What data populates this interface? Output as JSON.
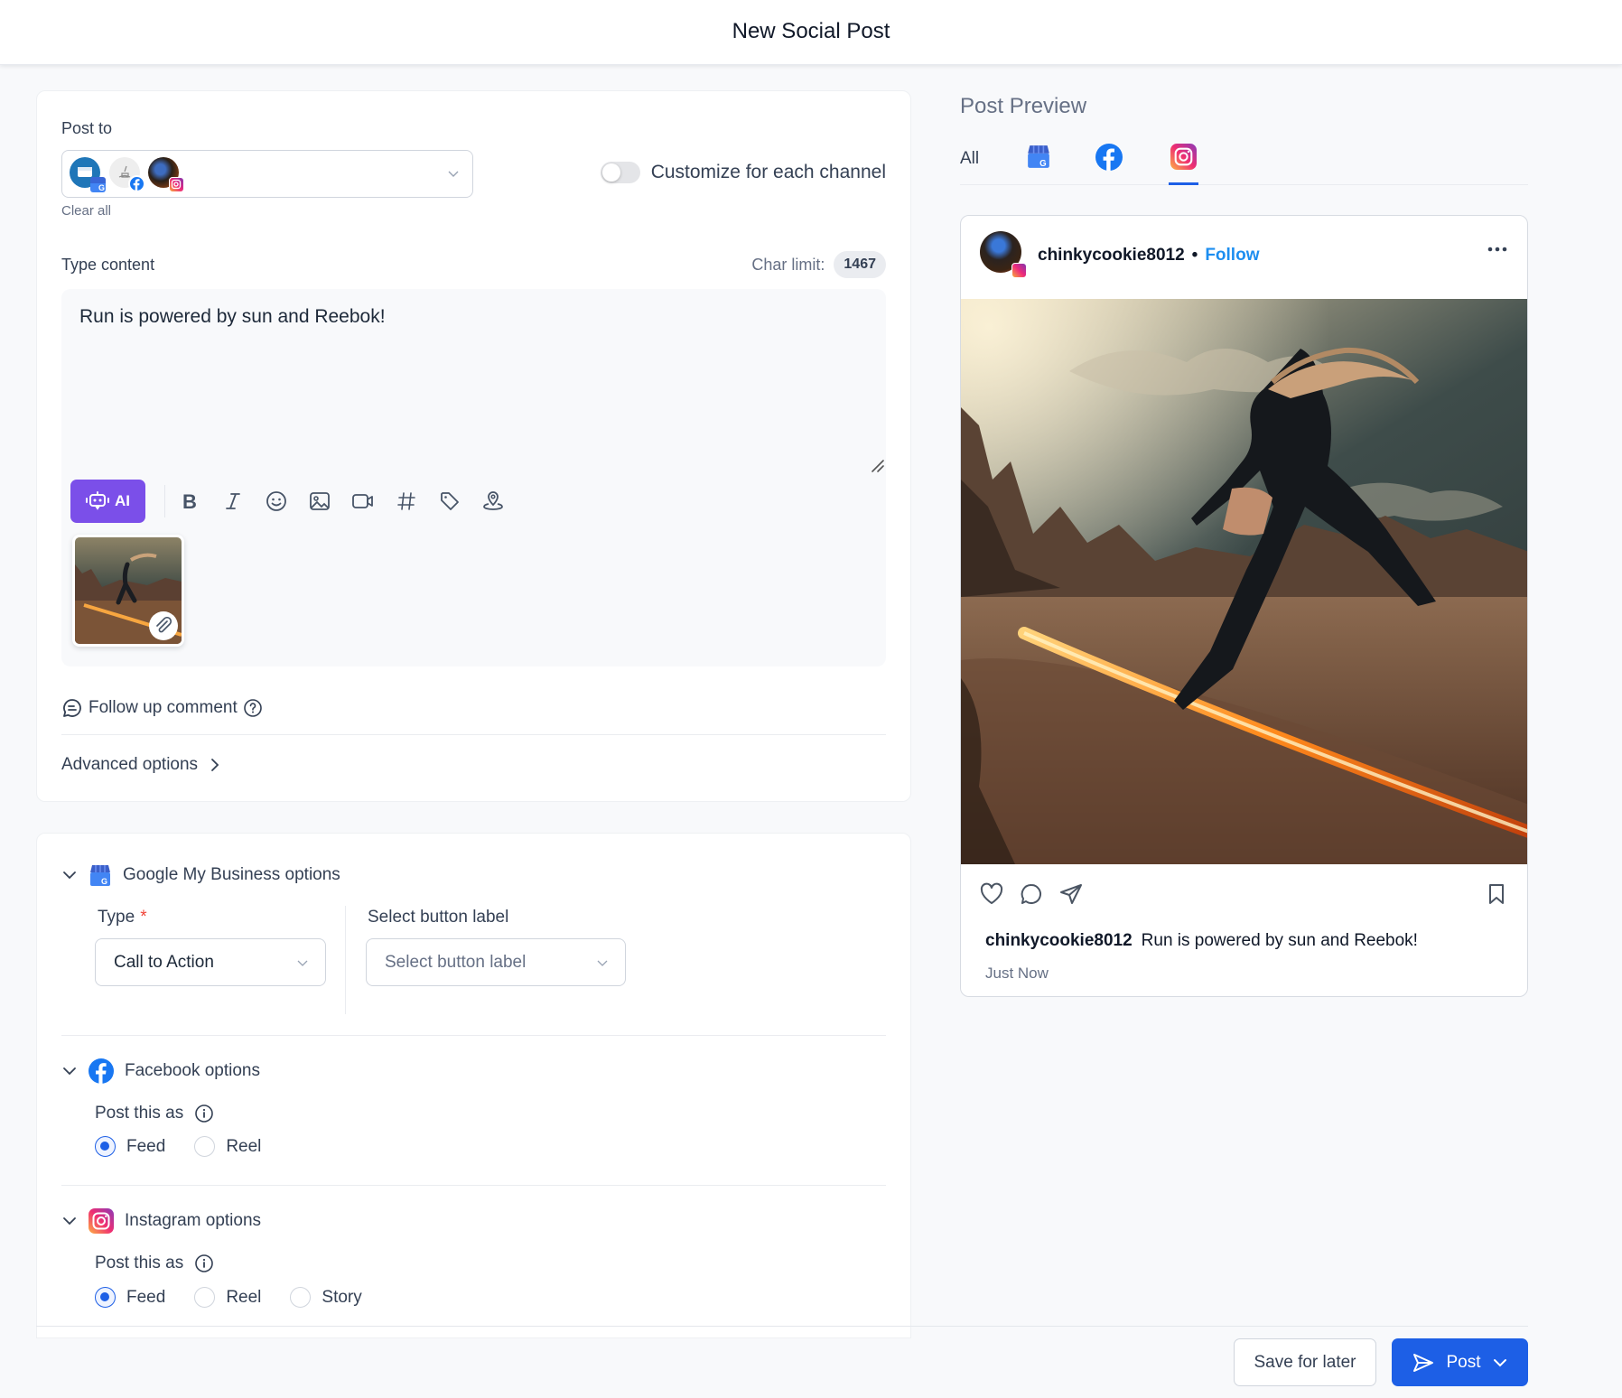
{
  "header": {
    "title": "New Social Post"
  },
  "compose": {
    "post_to_label": "Post to",
    "accounts": [
      {
        "name": "Google My Business account",
        "platform": "google-my-business"
      },
      {
        "name": "Facebook account",
        "platform": "facebook"
      },
      {
        "name": "Instagram account",
        "platform": "instagram"
      }
    ],
    "clear_all": "Clear all",
    "customize_toggle": {
      "label": "Customize for each channel",
      "on": false
    },
    "type_content_label": "Type content",
    "char_limit_label": "Char limit:",
    "char_limit_value": "1467",
    "content": "Run is powered by sun and Reebok!",
    "toolbar": {
      "ai_label": "AI",
      "icons": [
        "bold-icon",
        "italic-icon",
        "emoji-icon",
        "image-icon",
        "video-icon",
        "hashtag-icon",
        "tag-icon",
        "location-icon"
      ]
    },
    "follow_up_comment": "Follow up comment",
    "advanced_options": "Advanced options"
  },
  "options": {
    "gmb": {
      "title": "Google My Business options",
      "type_label": "Type",
      "type_required": "*",
      "type_value": "Call to Action",
      "button_label_label": "Select button label",
      "button_label_placeholder": "Select button label"
    },
    "facebook": {
      "title": "Facebook options",
      "post_as_label": "Post this as",
      "choices": [
        "Feed",
        "Reel"
      ],
      "selected": "Feed"
    },
    "instagram": {
      "title": "Instagram options",
      "post_as_label": "Post this as",
      "choices": [
        "Feed",
        "Reel",
        "Story"
      ],
      "selected": "Feed"
    }
  },
  "preview": {
    "title": "Post Preview",
    "tabs": [
      {
        "label": "All",
        "active": false
      },
      {
        "label": "Google My Business",
        "active": false
      },
      {
        "label": "Facebook",
        "active": false
      },
      {
        "label": "Instagram",
        "active": true
      }
    ],
    "username": "chinkycookie8012",
    "separator": "•",
    "follow": "Follow",
    "caption_user": "chinkycookie8012",
    "caption_text": "Run is powered by sun and Reebok!",
    "time": "Just Now"
  },
  "footer": {
    "save_label": "Save for later",
    "post_label": "Post"
  },
  "colors": {
    "primary": "#1d5fe6",
    "ai": "#7b4fe9",
    "follow": "#1d8ef0",
    "required": "#f04438",
    "facebook": "#1877f2"
  }
}
